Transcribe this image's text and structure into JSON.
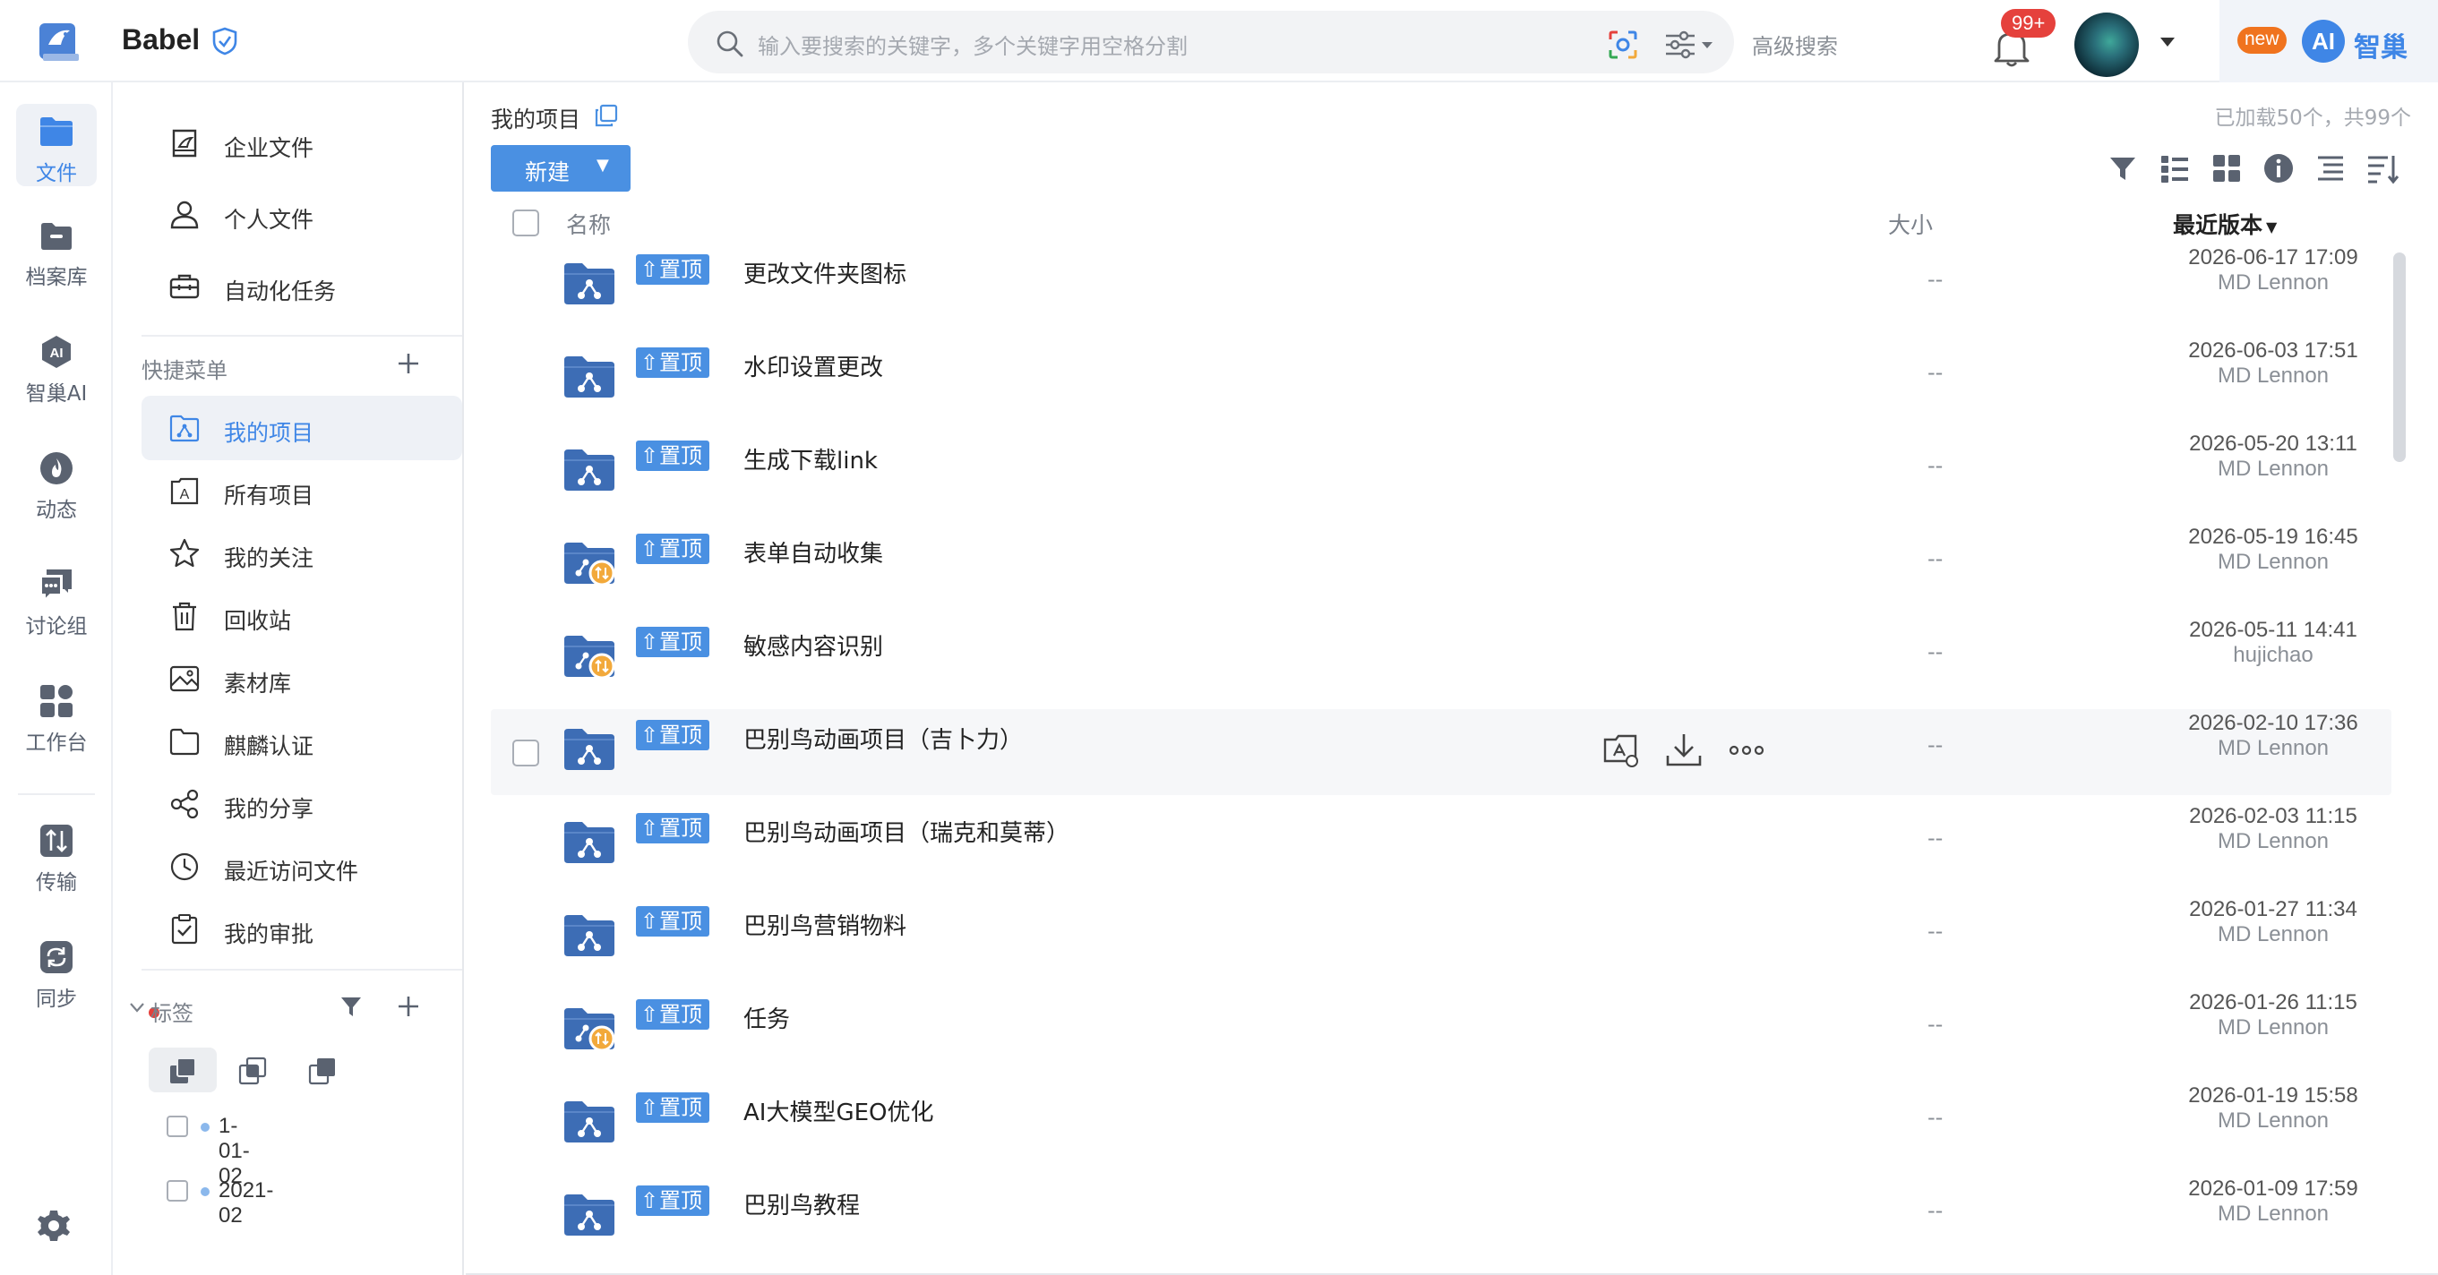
{
  "app": {
    "brand": "Babel",
    "colors": {
      "accent": "#3f86e6",
      "pin": "#4a90e2",
      "folder": "#3d6db5",
      "badge": "#e5413c",
      "new": "#f0731e"
    }
  },
  "header": {
    "search_placeholder": "输入要搜索的关键字，多个关键字用空格分割",
    "advanced_search": "高级搜索",
    "notification_count": "99+",
    "ai_new": "new",
    "ai_badge": "AI",
    "ai_label": "智巢"
  },
  "rail": {
    "items": [
      {
        "label": "文件",
        "icon": "folder-icon"
      },
      {
        "label": "档案库",
        "icon": "archive-icon"
      },
      {
        "label": "智巢AI",
        "icon": "ai-icon"
      },
      {
        "label": "动态",
        "icon": "fire-icon"
      },
      {
        "label": "讨论组",
        "icon": "chat-icon"
      },
      {
        "label": "工作台",
        "icon": "apps-icon"
      },
      {
        "label": "传输",
        "icon": "transfer-icon"
      },
      {
        "label": "同步",
        "icon": "sync-icon"
      }
    ]
  },
  "nav": {
    "top_items": [
      {
        "label": "企业文件",
        "icon": "enterprise-icon"
      },
      {
        "label": "个人文件",
        "icon": "person-icon"
      },
      {
        "label": "自动化任务",
        "icon": "toolbox-icon"
      }
    ],
    "quick_menu_title": "快捷菜单",
    "quick_items": [
      {
        "label": "我的项目",
        "icon": "project-icon"
      },
      {
        "label": "所有项目",
        "icon": "all-projects-icon"
      },
      {
        "label": "我的关注",
        "icon": "star-icon"
      },
      {
        "label": "回收站",
        "icon": "trash-icon"
      },
      {
        "label": "素材库",
        "icon": "image-icon"
      },
      {
        "label": "麒麟认证",
        "icon": "folder-outline-icon"
      },
      {
        "label": "我的分享",
        "icon": "share-icon"
      },
      {
        "label": "最近访问文件",
        "icon": "clock-icon"
      },
      {
        "label": "我的审批",
        "icon": "approval-icon"
      }
    ],
    "tags_title": "标签",
    "tags": [
      {
        "label": "1-01-02"
      },
      {
        "label": "2021-02"
      }
    ]
  },
  "main": {
    "breadcrumb": "我的项目",
    "loaded_info": "已加载50个，共99个",
    "new_button": "新建",
    "columns": {
      "name": "名称",
      "size": "大小",
      "version": "最近版本"
    },
    "pin_label": "置顶",
    "rows": [
      {
        "name": "更改文件夹图标",
        "size": "--",
        "date": "2026-06-17 17:09",
        "user": "MD Lennon",
        "folder_type": "shared"
      },
      {
        "name": "水印设置更改",
        "size": "--",
        "date": "2026-06-03 17:51",
        "user": "MD Lennon",
        "folder_type": "shared"
      },
      {
        "name": "生成下载link",
        "size": "--",
        "date": "2026-05-20 13:11",
        "user": "MD Lennon",
        "folder_type": "shared"
      },
      {
        "name": "表单自动收集",
        "size": "--",
        "date": "2026-05-19 16:45",
        "user": "MD Lennon",
        "folder_type": "sync"
      },
      {
        "name": "敏感内容识别",
        "size": "--",
        "date": "2026-05-11 14:41",
        "user": "hujichao",
        "folder_type": "sync"
      },
      {
        "name": "巴别鸟动画项目（吉卜力）",
        "size": "--",
        "date": "2026-02-10 17:36",
        "user": "MD Lennon",
        "folder_type": "shared"
      },
      {
        "name": "巴别鸟动画项目（瑞克和莫蒂）",
        "size": "--",
        "date": "2026-02-03 11:15",
        "user": "MD Lennon",
        "folder_type": "shared"
      },
      {
        "name": "巴别鸟营销物料",
        "size": "--",
        "date": "2026-01-27 11:34",
        "user": "MD Lennon",
        "folder_type": "shared"
      },
      {
        "name": "任务",
        "size": "--",
        "date": "2026-01-26 11:15",
        "user": "MD Lennon",
        "folder_type": "sync"
      },
      {
        "name": "AI大模型GEO优化",
        "size": "--",
        "date": "2026-01-19 15:58",
        "user": "MD Lennon",
        "folder_type": "shared"
      },
      {
        "name": "巴别鸟教程",
        "size": "--",
        "date": "2026-01-09 17:59",
        "user": "MD Lennon",
        "folder_type": "shared"
      }
    ]
  }
}
